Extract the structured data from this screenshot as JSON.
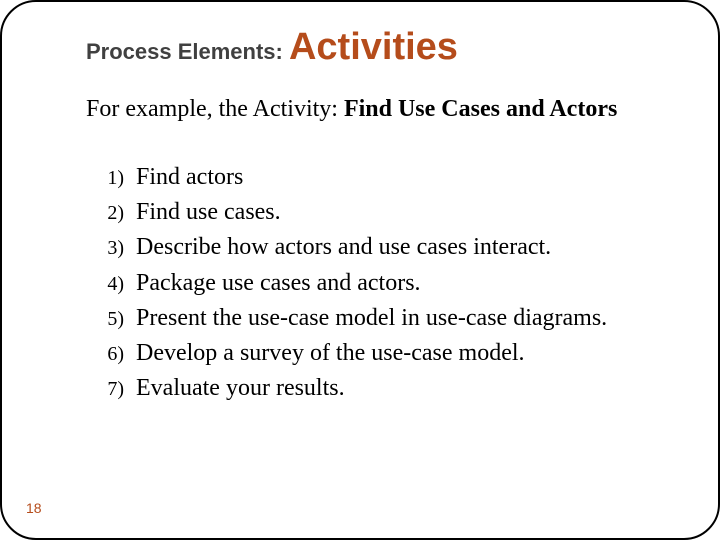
{
  "title": {
    "small": "Process Elements: ",
    "big": "Activities"
  },
  "intro": {
    "lead": "For example, the Activity: ",
    "bold": "Find Use Cases and Actors"
  },
  "list": [
    {
      "num": "1)",
      "text": "Find actors"
    },
    {
      "num": "2)",
      "text": "Find use cases."
    },
    {
      "num": "3)",
      "text": "Describe how actors and use cases interact."
    },
    {
      "num": "4)",
      "text": "Package use cases and actors."
    },
    {
      "num": "5)",
      "text": "Present the use-case model in use-case diagrams."
    },
    {
      "num": "6)",
      "text": "Develop a survey of the use-case model."
    },
    {
      "num": "7)",
      "text": "Evaluate your results."
    }
  ],
  "page_number": "18"
}
